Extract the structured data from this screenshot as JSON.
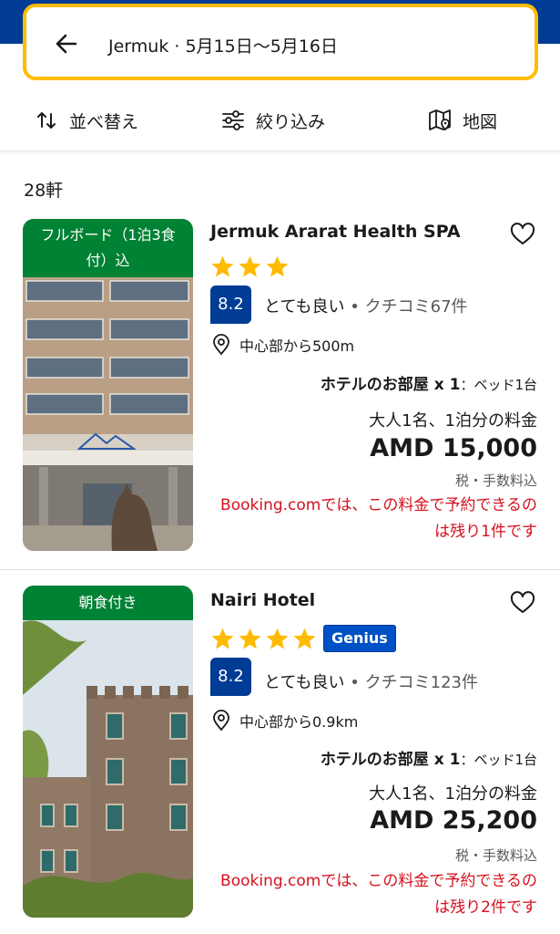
{
  "search": {
    "destination": "Jermuk",
    "dates": " · 5月15日〜5月16日"
  },
  "toolbar": {
    "sort_label": "並べ替え",
    "filter_label": "絞り込み",
    "map_label": "地図"
  },
  "results": {
    "count_label": "28軒"
  },
  "hotels": [
    {
      "badge": "フルボード（1泊3食付）込",
      "name": "Jermuk Ararat Health SPA",
      "stars": 3,
      "genius": "",
      "score": "8.2",
      "review_word": "とても良い",
      "review_sep": " • ",
      "review_count": "クチコミ67件",
      "distance": "中心部から500m",
      "room_type": "ホテルのお部屋 x 1",
      "beds": "：ベッド1台",
      "guests_nights": "大人1名、1泊分の料金",
      "price": "AMD 15,000",
      "tax_note": "税・手数料込",
      "availability": "Booking.comでは、この料金で予約できるのは残り1件です"
    },
    {
      "badge": "朝食付き",
      "name": "Nairi Hotel",
      "stars": 4,
      "genius": "Genius",
      "score": "8.2",
      "review_word": "とても良い",
      "review_sep": " • ",
      "review_count": "クチコミ123件",
      "distance": "中心部から0.9km",
      "room_type": "ホテルのお部屋 x 1",
      "beds": "：ベッド1台",
      "guests_nights": "大人1名、1泊分の料金",
      "price": "AMD 25,200",
      "tax_note": "税・手数料込",
      "availability": "Booking.comでは、この料金で予約できるのは残り2件です"
    }
  ],
  "colors": {
    "brand_blue": "#003b95",
    "search_border": "#febb02",
    "badge_green": "#008234",
    "star_yellow": "#febb02",
    "genius_blue": "#0051c5",
    "urgency_red": "#d4111e"
  }
}
